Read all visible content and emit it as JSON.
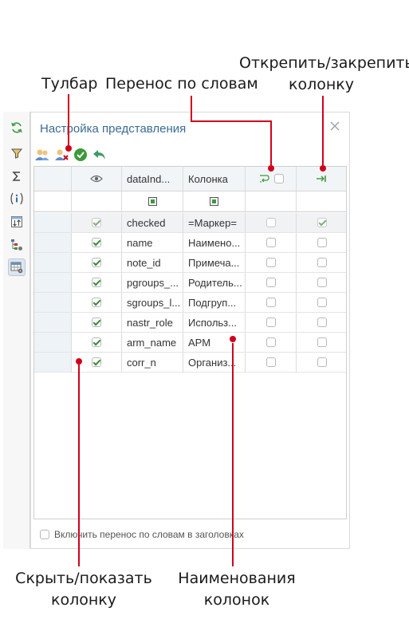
{
  "callouts": {
    "toolbar": "Тулбар",
    "wrap": "Перенос по словам",
    "pin_line1": "Открепить/закрепить",
    "pin_line2": "колонку",
    "hide_line1": "Скрыть/показать",
    "hide_line2": "колонку",
    "names_line1": "Наименования",
    "names_line2": "колонок"
  },
  "left_strip": {
    "icons": [
      "refresh-icon",
      "filter-icon",
      "sigma-icon",
      "info-icon",
      "sort-icon",
      "tree-settings-icon",
      "table-settings-icon"
    ]
  },
  "panel": {
    "title": "Настройка представления",
    "close_icon": "close-icon",
    "footer_checkbox_label": "Включить перенос по словам в заголовках",
    "footer_checked": false
  },
  "toolbar": {
    "buttons": [
      "users-icon",
      "user-remove-icon",
      "check-circle-icon",
      "undo-icon"
    ]
  },
  "grid": {
    "columns": {
      "visible": "eye-icon",
      "dataindex": "dataInd...",
      "name": "Колонка",
      "wrap": "wrap-icon",
      "pin": "pin-icon"
    },
    "rows": [
      {
        "visible": true,
        "dataindex": "checked",
        "name": "=Маркер=",
        "wrap": false,
        "pin": true
      },
      {
        "visible": true,
        "dataindex": "name",
        "name": "Наимено...",
        "wrap": false,
        "pin": false
      },
      {
        "visible": true,
        "dataindex": "note_id",
        "name": "Примеча...",
        "wrap": false,
        "pin": false
      },
      {
        "visible": true,
        "dataindex": "pgroups_...",
        "name": "Родитель...",
        "wrap": false,
        "pin": false
      },
      {
        "visible": true,
        "dataindex": "sgroups_l...",
        "name": "Подгруп...",
        "wrap": false,
        "pin": false
      },
      {
        "visible": true,
        "dataindex": "nastr_role",
        "name": "Использ...",
        "wrap": false,
        "pin": false
      },
      {
        "visible": true,
        "dataindex": "arm_name",
        "name": "АРМ",
        "wrap": false,
        "pin": false
      },
      {
        "visible": true,
        "dataindex": "corr_n",
        "name": "Организ...",
        "wrap": false,
        "pin": false
      }
    ]
  },
  "colors": {
    "title": "#3b6b94",
    "arrow": "#d0021b",
    "check": "#3c8a3c"
  }
}
